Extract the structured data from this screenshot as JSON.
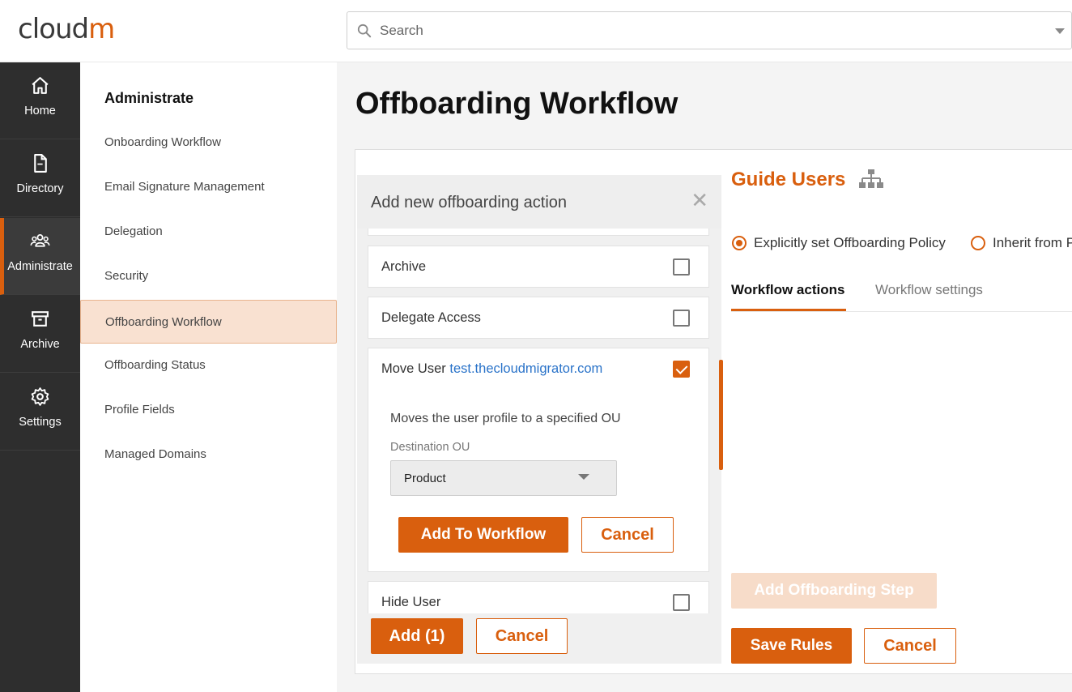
{
  "header": {
    "logo_text": "cloud",
    "logo_accent": "m",
    "search_placeholder": "Search"
  },
  "rail": [
    {
      "label": "Home",
      "icon": "home-icon"
    },
    {
      "label": "Directory",
      "icon": "document-icon"
    },
    {
      "label": "Administrate",
      "icon": "users-icon",
      "active": true
    },
    {
      "label": "Archive",
      "icon": "archive-box-icon"
    },
    {
      "label": "Settings",
      "icon": "gear-icon"
    }
  ],
  "subnav": {
    "title": "Administrate",
    "items": [
      {
        "label": "Onboarding Workflow"
      },
      {
        "label": "Email Signature Management"
      },
      {
        "label": "Delegation"
      },
      {
        "label": "Security"
      },
      {
        "label": "Offboarding Workflow",
        "active": true
      },
      {
        "label": "Offboarding Status"
      },
      {
        "label": "Profile Fields"
      },
      {
        "label": "Managed Domains"
      }
    ]
  },
  "main": {
    "page_title": "Offboarding Workflow"
  },
  "panel": {
    "title": "Add new offboarding action",
    "close_glyph": "✕",
    "options": [
      {
        "label": "Archive",
        "checked": false
      },
      {
        "label": "Delegate Access",
        "checked": false
      },
      {
        "label": "Move User",
        "link": "test.thecloudmigrator.com",
        "checked": true
      },
      {
        "label": "Hide User",
        "checked": false
      }
    ],
    "move_user": {
      "description": "Moves the user profile to a specified OU",
      "destination_label": "Destination OU",
      "destination_value": "Product",
      "add_button": "Add To Workflow",
      "cancel_button": "Cancel"
    },
    "footer": {
      "add_button": "Add (1)",
      "cancel_button": "Cancel"
    }
  },
  "right": {
    "title": "Guide Users",
    "policy_options": [
      {
        "label": "Explicitly set Offboarding Policy",
        "selected": true
      },
      {
        "label": "Inherit from P",
        "selected": false
      }
    ],
    "tabs": [
      {
        "label": "Workflow actions",
        "active": true
      },
      {
        "label": "Workflow settings",
        "active": false
      }
    ],
    "add_step_button": "Add Offboarding Step",
    "save_button": "Save Rules",
    "cancel_button": "Cancel"
  },
  "colors": {
    "accent": "#d95f0e",
    "accent_light": "#f9e1d1",
    "rail_bg": "#2e2e2e",
    "link": "#2a73c9"
  }
}
